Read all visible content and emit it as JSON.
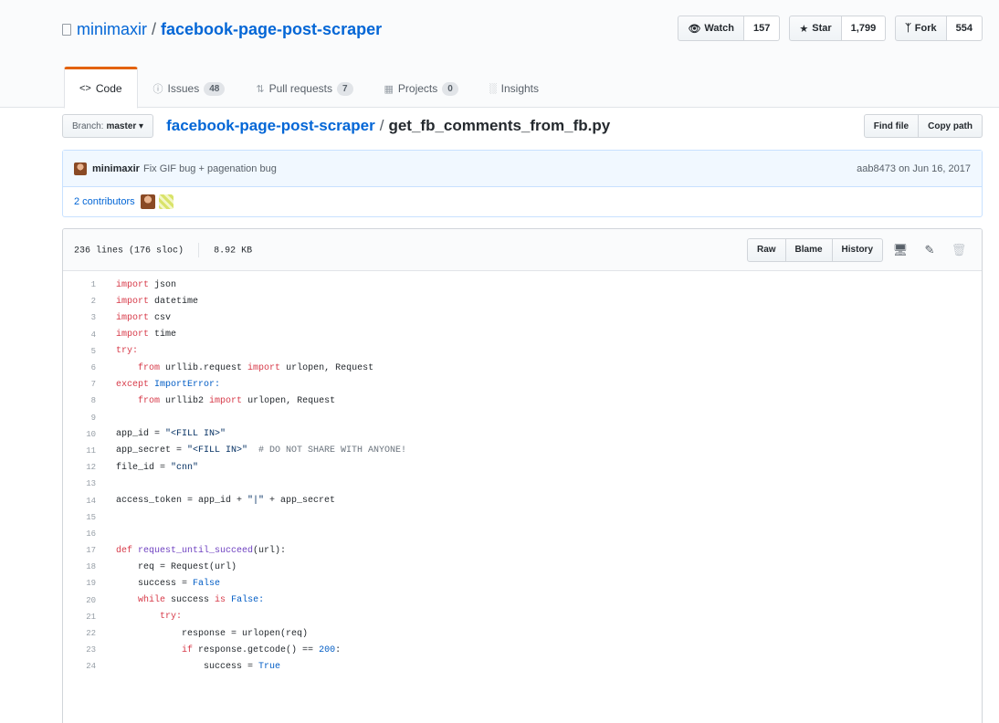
{
  "repo": {
    "owner": "minimaxir",
    "separator": "/",
    "name": "facebook-page-post-scraper"
  },
  "actions": {
    "watch": {
      "label": "Watch",
      "count": "157"
    },
    "star": {
      "label": "Star",
      "count": "1,799"
    },
    "fork": {
      "label": "Fork",
      "count": "554"
    }
  },
  "nav": {
    "code": {
      "label": "Code"
    },
    "issues": {
      "label": "Issues",
      "count": "48"
    },
    "pulls": {
      "label": "Pull requests",
      "count": "7"
    },
    "projects": {
      "label": "Projects",
      "count": "0"
    },
    "insights": {
      "label": "Insights"
    }
  },
  "file_nav": {
    "branch_label": "Branch:",
    "branch_value": "master",
    "breadcrumb_root": "facebook-page-post-scraper",
    "breadcrumb_sep": "/",
    "breadcrumb_file": "get_fb_comments_from_fb.py",
    "find_file": "Find file",
    "copy_path": "Copy path"
  },
  "commit": {
    "author": "minimaxir",
    "message": "Fix GIF bug + pagenation bug",
    "sha": "aab8473",
    "date_prefix": "on",
    "date": "Jun 16, 2017",
    "contributors": "2 contributors"
  },
  "file": {
    "lines_info": "236 lines (176 sloc)",
    "size": "8.92 KB",
    "raw": "Raw",
    "blame": "Blame",
    "history": "History"
  },
  "code": [
    {
      "n": "1"
    },
    {
      "n": "2"
    },
    {
      "n": "3"
    },
    {
      "n": "4"
    },
    {
      "n": "5"
    },
    {
      "n": "6"
    },
    {
      "n": "7"
    },
    {
      "n": "8"
    },
    {
      "n": "9"
    },
    {
      "n": "10"
    },
    {
      "n": "11"
    },
    {
      "n": "12"
    },
    {
      "n": "13"
    },
    {
      "n": "14"
    },
    {
      "n": "15"
    },
    {
      "n": "16"
    },
    {
      "n": "17"
    },
    {
      "n": "18"
    },
    {
      "n": "19"
    },
    {
      "n": "20"
    },
    {
      "n": "21"
    },
    {
      "n": "22"
    },
    {
      "n": "23"
    },
    {
      "n": "24"
    }
  ],
  "tokens": {
    "import": "import",
    "json": " json",
    "datetime": " datetime",
    "csv": " csv",
    "time": " time",
    "try": "try:",
    "from": "from",
    "urllib_request": " urllib.request ",
    "urlopen_request": " urlopen, Request",
    "except": "except",
    "ImportError": " ImportError:",
    "urllib2": " urllib2 ",
    "app_id_lhs": "app_id = ",
    "fill_in": "\"<FILL IN>\"",
    "app_secret_lhs": "app_secret = ",
    "share_comment": "  # DO NOT SHARE WITH ANYONE!",
    "file_id_lhs": "file_id = ",
    "cnn": "\"cnn\"",
    "access_token_lhs": "access_token = app_id + ",
    "pipe": "\"|\"",
    "access_token_rhs": " + app_secret",
    "def": "def",
    "request_until_succeed": " request_until_succeed",
    "url_param": "(url):",
    "req_line": "req = Request(url)",
    "success_eq": "success = ",
    "false_kw": "False",
    "while": "while",
    "while_mid": " success ",
    "is": "is",
    "false_colon": " False:",
    "try_inner": "try:",
    "response_line": "response = urlopen(req)",
    "if": "if",
    "getcode": " response.getcode() == ",
    "n200": "200",
    "colon": ":",
    "true_kw": "True"
  }
}
